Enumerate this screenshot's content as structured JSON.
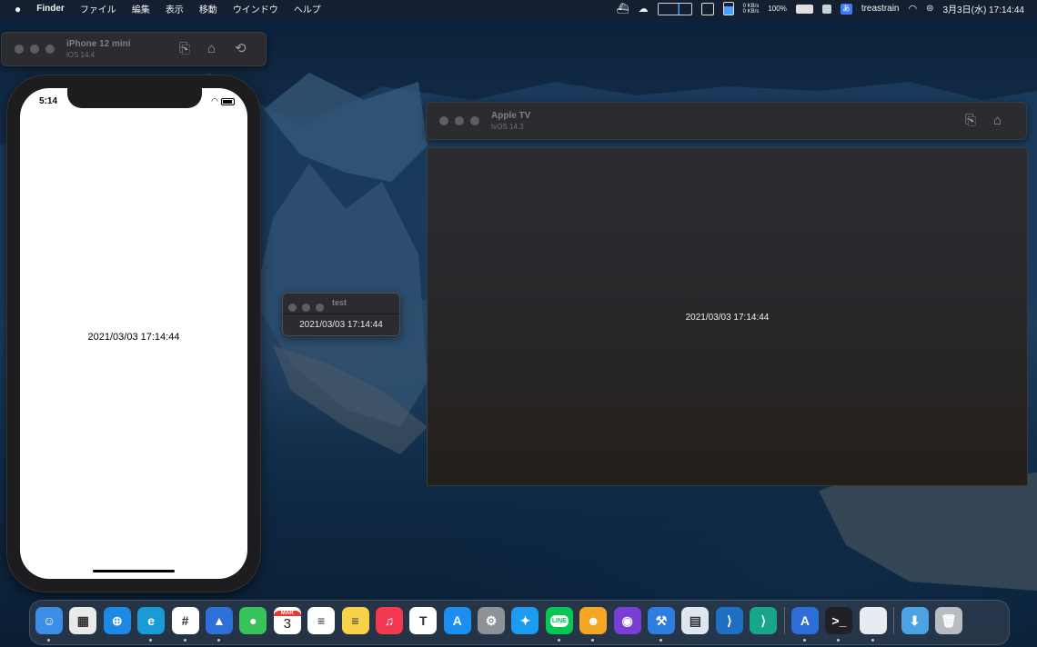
{
  "menubar": {
    "apple": "",
    "app": "Finder",
    "items": [
      "ファイル",
      "編集",
      "表示",
      "移動",
      "ウインドウ",
      "ヘルプ"
    ],
    "net_up": "0 KB/s",
    "net_down": "0 KB/s",
    "battery": "100%",
    "ime": "あ",
    "user": "treastrain",
    "datetime": "3月3日(水) 17:14:44"
  },
  "iphone_sim": {
    "title": "iPhone 12 mini",
    "subtitle": "iOS 14.4",
    "status_time": "5:14",
    "content_text": "2021/03/03 17:14:44"
  },
  "appletv_sim": {
    "title": "Apple TV",
    "subtitle": "tvOS 14.3",
    "content_text": "2021/03/03 17:14:44"
  },
  "test_window": {
    "title": "test",
    "content_text": "2021/03/03 17:14:44"
  },
  "dock": {
    "calendar_day": "3",
    "calendar_month": "MAR",
    "line_label": "LINE",
    "apps": [
      {
        "name": "finder",
        "color": "#3b8de8",
        "glyph": "☺",
        "running": true
      },
      {
        "name": "launchpad",
        "color": "#e9e9ea",
        "glyph": "▦",
        "running": false
      },
      {
        "name": "safari",
        "color": "#1e88e5",
        "glyph": "⊕",
        "running": false
      },
      {
        "name": "edge",
        "color": "#1a9ad6",
        "glyph": "e",
        "running": true
      },
      {
        "name": "slack",
        "color": "#ffffff",
        "glyph": "#",
        "running": true
      },
      {
        "name": "spark",
        "color": "#2f6fd8",
        "glyph": "▲",
        "running": true
      },
      {
        "name": "messages",
        "color": "#37c35a",
        "glyph": "●",
        "running": false
      },
      {
        "name": "calendar",
        "color": "#ffffff",
        "glyph": "",
        "running": false
      },
      {
        "name": "reminders",
        "color": "#ffffff",
        "glyph": "≡",
        "running": false
      },
      {
        "name": "notes",
        "color": "#f6d24a",
        "glyph": "≡",
        "running": false
      },
      {
        "name": "music",
        "color": "#f2394f",
        "glyph": "♫",
        "running": false
      },
      {
        "name": "keynote",
        "color": "#ffffff",
        "glyph": "T",
        "running": false
      },
      {
        "name": "app-store",
        "color": "#1c8ef0",
        "glyph": "A",
        "running": false
      },
      {
        "name": "system-preferences",
        "color": "#8e9196",
        "glyph": "⚙",
        "running": false
      },
      {
        "name": "twitter",
        "color": "#1d9bf0",
        "glyph": "✦",
        "running": false
      },
      {
        "name": "line",
        "color": "#06c755",
        "glyph": "",
        "running": true
      },
      {
        "name": "discord",
        "color": "#f5a623",
        "glyph": "☻",
        "running": true
      },
      {
        "name": "github-desktop",
        "color": "#7a3ed6",
        "glyph": "◉",
        "running": false
      },
      {
        "name": "xcode",
        "color": "#2f7de1",
        "glyph": "⚒",
        "running": true
      },
      {
        "name": "preview",
        "color": "#dfe6ef",
        "glyph": "▤",
        "running": false
      },
      {
        "name": "vscode",
        "color": "#1f6fc2",
        "glyph": "⟩",
        "running": false
      },
      {
        "name": "vscode-insiders",
        "color": "#17a689",
        "glyph": "⟩",
        "running": false
      },
      {
        "name": "sep1",
        "color": "",
        "glyph": "",
        "running": false
      },
      {
        "name": "simulator",
        "color": "#2d6fd6",
        "glyph": "A",
        "running": true
      },
      {
        "name": "terminal",
        "color": "#202124",
        "glyph": ">_",
        "running": true
      },
      {
        "name": "blank-app",
        "color": "#e8ebef",
        "glyph": "",
        "running": true
      },
      {
        "name": "sep2",
        "color": "",
        "glyph": "",
        "running": false
      },
      {
        "name": "downloads",
        "color": "#4ba3e3",
        "glyph": "⬇",
        "running": false
      },
      {
        "name": "trash",
        "color": "#b9bcc1",
        "glyph": "🗑",
        "running": false
      }
    ]
  }
}
